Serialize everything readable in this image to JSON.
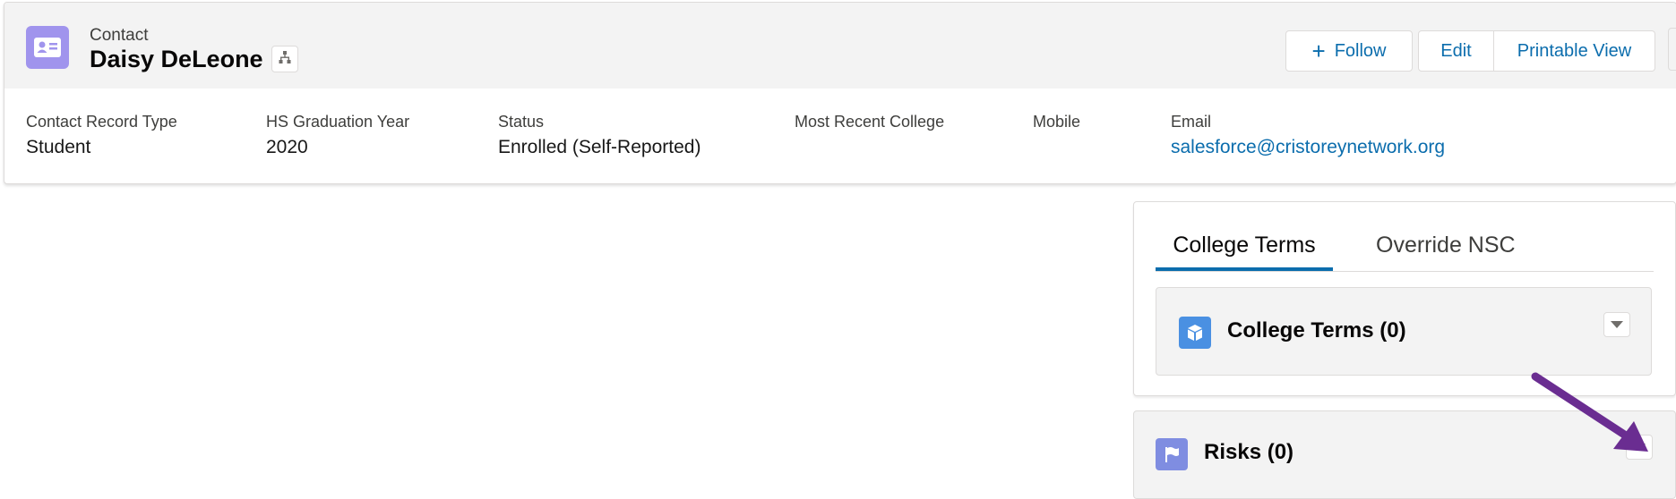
{
  "header": {
    "object_label": "Contact",
    "record_name": "Daisy DeLeone",
    "icons": {
      "object": "contact-card-icon",
      "hierarchy": "hierarchy-icon",
      "follow": "plus-icon"
    },
    "actions": {
      "follow": "Follow",
      "edit": "Edit",
      "printable_view": "Printable View"
    }
  },
  "fields": [
    {
      "label": "Contact Record Type",
      "value": "Student"
    },
    {
      "label": "HS Graduation Year",
      "value": "2020"
    },
    {
      "label": "Status",
      "value": "Enrolled (Self-Reported)"
    },
    {
      "label": "Most Recent College",
      "value": ""
    },
    {
      "label": "Mobile",
      "value": ""
    },
    {
      "label": "Email",
      "value": "salesforce@cristoreynetwork.org"
    }
  ],
  "tabs": [
    {
      "label": "College Terms",
      "active": true
    },
    {
      "label": "Override NSC",
      "active": false
    }
  ],
  "related_lists": {
    "college_terms": {
      "title": "College Terms (0)",
      "icon": "cube-icon",
      "icon_color": "#4a90e2"
    },
    "risks": {
      "title": "Risks (0)",
      "icon": "flag-icon",
      "icon_color": "#7f8de1"
    }
  },
  "colors": {
    "brand_link": "#0b6dad",
    "contact_icon": "#a094ed",
    "annotation_arrow": "#6a2d91"
  }
}
